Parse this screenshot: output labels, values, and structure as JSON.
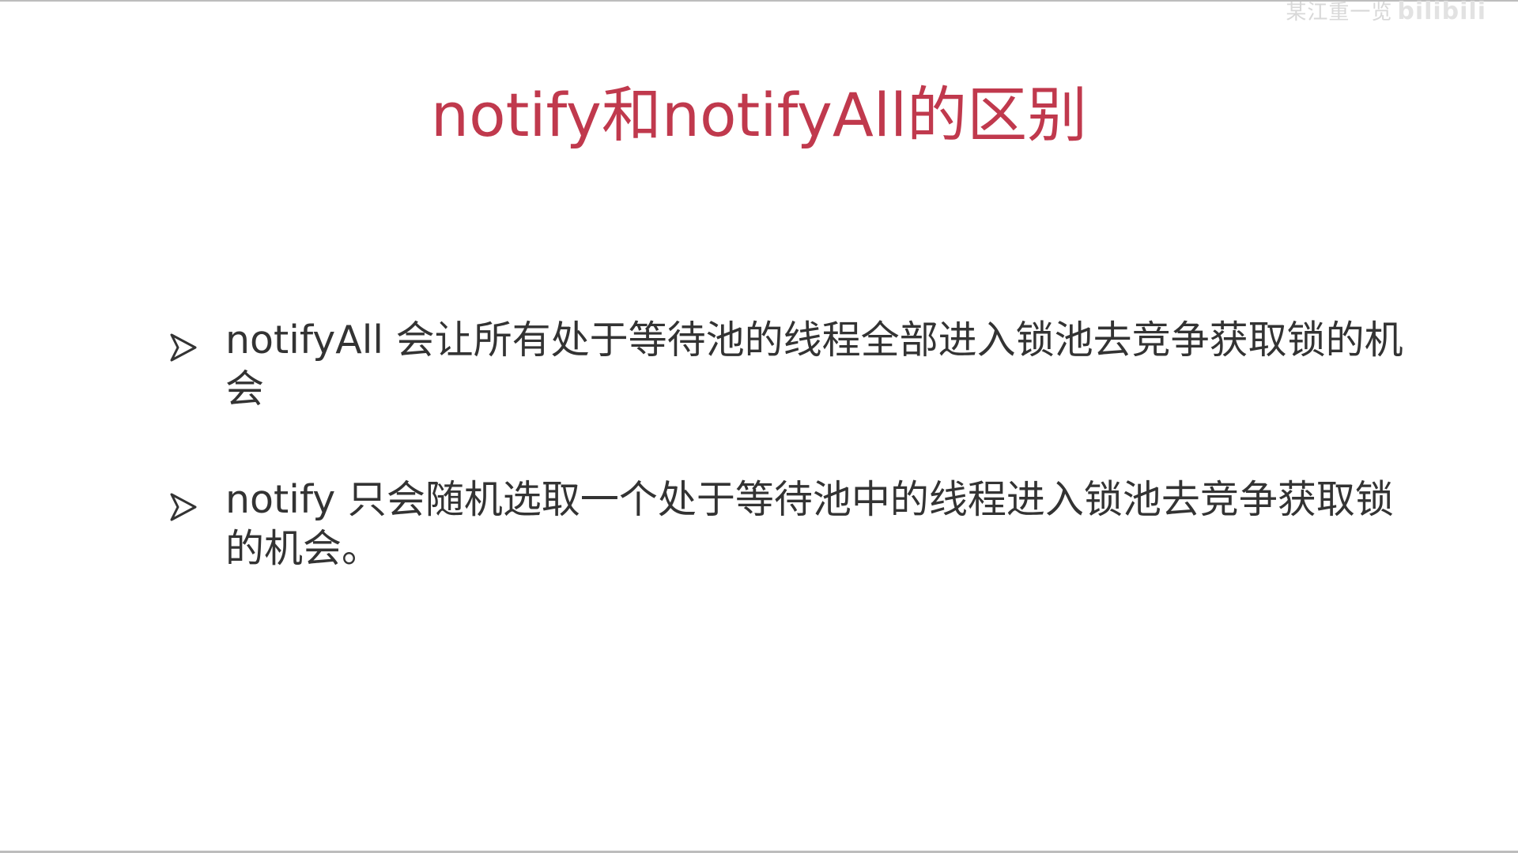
{
  "slide": {
    "title": "notify和notifyAll的区别",
    "title_color": "#c0394d",
    "text_color": "#333333",
    "bullet_icon": "arrowhead-bullet-icon",
    "bullets": [
      {
        "text": "notifyAll 会让所有处于等待池的线程全部进入锁池去竞争获取锁的机会"
      },
      {
        "text": "notify 只会随机选取一个处于等待池中的线程进入锁池去竞争获取锁的机会。"
      }
    ]
  },
  "watermark": {
    "channel": "某江重一览",
    "logo": "bilibili"
  }
}
